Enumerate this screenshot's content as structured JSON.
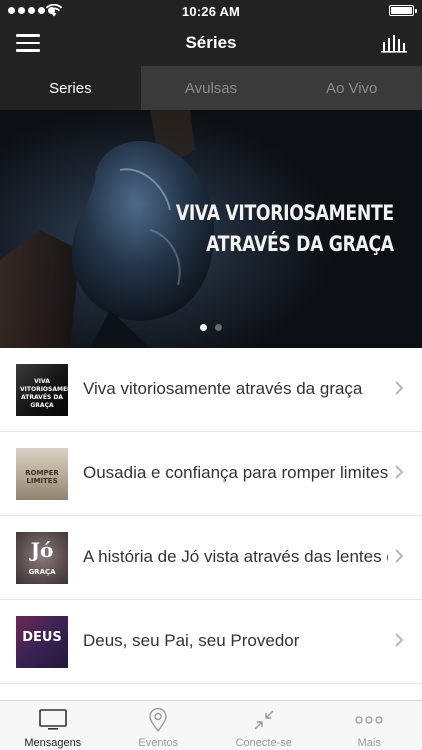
{
  "status_bar": {
    "time": "10:26 AM"
  },
  "nav": {
    "title": "Séries",
    "menu_icon": "hamburger-menu-icon",
    "right_icon": "bar-chart-icon"
  },
  "tabs": [
    {
      "label": "Series",
      "active": true
    },
    {
      "label": "Avulsas",
      "active": false
    },
    {
      "label": "Ao Vivo",
      "active": false
    }
  ],
  "hero": {
    "title_line1": "VIVA VITORIOSAMENTE",
    "title_line2": "ATRAVÉS DA GRAÇA",
    "pages": 2,
    "current_page": 1
  },
  "list": [
    {
      "label": "Viva vitoriosamente através da graça",
      "thumb_text": "VIVA VITORIOSAMENTE ATRAVÉS DA GRAÇA"
    },
    {
      "label": "Ousadia e confiança para romper limites",
      "thumb_text": "ROMPER LIMITES"
    },
    {
      "label": "A história de Jó vista através das lentes da graça",
      "thumb_text_a": "Jó",
      "thumb_text_b": "GRAÇA"
    },
    {
      "label": "Deus, seu Pai, seu Provedor",
      "thumb_text": "DEUS"
    }
  ],
  "tabbar": [
    {
      "label": "Mensagens",
      "icon": "tv-icon",
      "active": true
    },
    {
      "label": "Eventos",
      "icon": "location-pin-icon",
      "active": false
    },
    {
      "label": "Conecte-se",
      "icon": "connect-arrows-icon",
      "active": false
    },
    {
      "label": "Mais",
      "icon": "more-dots-icon",
      "active": false
    }
  ]
}
